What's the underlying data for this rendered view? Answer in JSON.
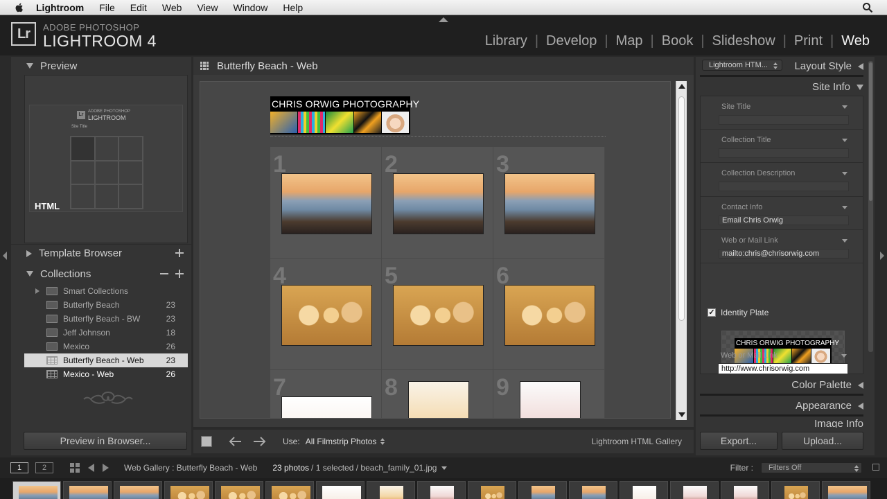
{
  "menubar": {
    "app": "Lightroom",
    "items": [
      "File",
      "Edit",
      "Web",
      "View",
      "Window",
      "Help"
    ]
  },
  "topbar": {
    "brand_small": "ADOBE PHOTOSHOP",
    "brand_big": "LIGHTROOM 4",
    "logo": "Lr",
    "modules": [
      "Library",
      "Develop",
      "Map",
      "Book",
      "Slideshow",
      "Print",
      "Web"
    ],
    "active_module": "Web"
  },
  "left": {
    "preview_label": "Preview",
    "preview": {
      "logo": "Lr",
      "brand1": "ADOBE PHOTOSHOP",
      "brand2": "LIGHTROOM",
      "site_title": "Site Title",
      "badge": "HTML"
    },
    "template_browser_label": "Template Browser",
    "collections_label": "Collections",
    "collections": [
      {
        "name": "Smart Collections",
        "count": "",
        "type": "smart"
      },
      {
        "name": "Butterfly Beach",
        "count": "23",
        "type": "collection"
      },
      {
        "name": "Butterfly Beach - BW",
        "count": "23",
        "type": "collection"
      },
      {
        "name": "Jeff Johnson",
        "count": "18",
        "type": "collection"
      },
      {
        "name": "Mexico",
        "count": "26",
        "type": "collection"
      },
      {
        "name": "Butterfly Beach - Web",
        "count": "23",
        "type": "web",
        "selected": true
      },
      {
        "name": "Mexico - Web",
        "count": "26",
        "type": "web"
      }
    ],
    "preview_browser_btn": "Preview in Browser..."
  },
  "center": {
    "title": "Butterfly Beach - Web",
    "site_plate_text": "CHRIS ORWIG PHOTOGRAPHY",
    "cells": [
      {
        "num": "1",
        "style": "p-beach"
      },
      {
        "num": "2",
        "style": "p-beach"
      },
      {
        "num": "3",
        "style": "p-beach"
      },
      {
        "num": "4",
        "style": "p-sand"
      },
      {
        "num": "5",
        "style": "p-sand"
      },
      {
        "num": "6",
        "style": "p-sand"
      },
      {
        "num": "7",
        "style": "p-white"
      },
      {
        "num": "8",
        "style": "p-sunset"
      },
      {
        "num": "9",
        "style": "p-pink"
      }
    ],
    "toolbar": {
      "use_label": "Use:",
      "use_value": "All Filmstrip Photos",
      "engine": "Lightroom HTML Gallery"
    }
  },
  "right": {
    "layout_select": "Lightroom HTM...",
    "layout_style_label": "Layout Style",
    "site_info_label": "Site Info",
    "fields": [
      {
        "label": "Site Title",
        "value": ""
      },
      {
        "label": "Collection Title",
        "value": ""
      },
      {
        "label": "Collection Description",
        "value": ""
      },
      {
        "label": "Contact Info",
        "value": "Email Chris Orwig"
      },
      {
        "label": "Web or Mail Link",
        "value": "mailto:chris@chrisorwig.com"
      }
    ],
    "identity_plate_label": "Identity Plate",
    "identity_plate_checked": "✓",
    "identity_plate_text": "CHRIS ORWIG PHOTOGRAPHY",
    "link_field": {
      "label": "Web or Mail Link",
      "value": "http://www.chrisorwig.com"
    },
    "color_palette_label": "Color Palette",
    "appearance_label": "Appearance",
    "image_info_label": "Image Info",
    "export_btn": "Export...",
    "upload_btn": "Upload..."
  },
  "filmbar": {
    "monitor1": "1",
    "monitor2": "2",
    "source": "Web Gallery : Butterfly Beach - Web",
    "count": "23 photos",
    "selection": "/ 1 selected / beach_family_01.jpg",
    "filter_label": "Filter :",
    "filter_value": "Filters Off"
  },
  "colors": {
    "accent_active": "#f2f2f2",
    "panel": "#343434",
    "selected_row": "#d8d8d8"
  }
}
